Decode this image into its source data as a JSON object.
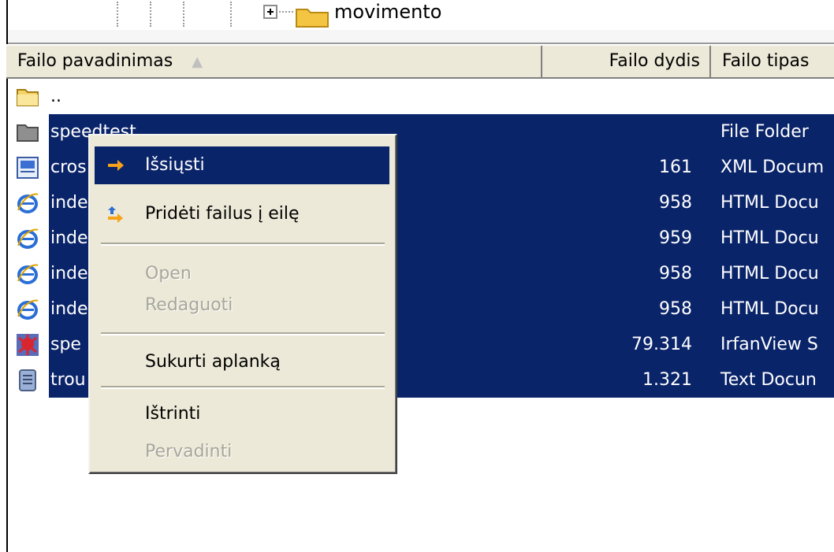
{
  "tree": {
    "folder_label": "movimento"
  },
  "columns": {
    "name": "Failo pavadinimas",
    "size": "Failo dydis",
    "type": "Failo tipas",
    "sort_indicator": "▲"
  },
  "rows": [
    {
      "name": "..",
      "size": "",
      "type": "",
      "icon": "folder-open-icon",
      "selected": false
    },
    {
      "name": "speedtest",
      "size": "",
      "type": "File Folder",
      "icon": "folder-icon",
      "selected": true
    },
    {
      "name": "cros",
      "size": "161",
      "type": "XML Docum",
      "icon": "xml-document-icon",
      "selected": true
    },
    {
      "name": "inde",
      "size": "958",
      "type": "HTML Docu",
      "icon": "ie-html-icon",
      "selected": true
    },
    {
      "name": "inde",
      "size": "959",
      "type": "HTML Docu",
      "icon": "ie-html-icon",
      "selected": true
    },
    {
      "name": "inde",
      "size": "958",
      "type": "HTML Docu",
      "icon": "ie-html-icon",
      "selected": true
    },
    {
      "name": "inde",
      "size": "958",
      "type": "HTML Docu",
      "icon": "ie-html-icon",
      "selected": true
    },
    {
      "name": "spe",
      "size": "79.314",
      "type": "IrfanView S",
      "icon": "irfanview-icon",
      "selected": true
    },
    {
      "name": "trou",
      "size": "1.321",
      "type": "Text Docun",
      "icon": "text-document-icon",
      "selected": true
    }
  ],
  "context_menu": {
    "items": [
      {
        "label": "Išsiųsti",
        "enabled": true,
        "highlighted": true,
        "icon": "arrow-right-icon"
      },
      {
        "label": "Pridėti failus į eilę",
        "enabled": true,
        "highlighted": false,
        "icon": "add-to-queue-icon"
      },
      {
        "label": "Open",
        "enabled": false
      },
      {
        "label": "Redaguoti",
        "enabled": false
      },
      {
        "label": "Sukurti aplanką",
        "enabled": true
      },
      {
        "label": "Ištrinti",
        "enabled": true
      },
      {
        "label": "Pervadinti",
        "enabled": false
      }
    ]
  },
  "colors": {
    "selection": "#0a246a",
    "menu_bg": "#ece9d8",
    "disabled_text": "#a7a69a"
  }
}
